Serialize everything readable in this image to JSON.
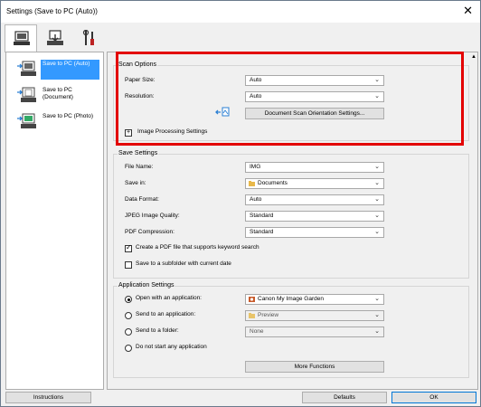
{
  "window": {
    "title": "Settings (Save to PC (Auto))",
    "close_glyph": "✕"
  },
  "tabs": [
    {
      "icon": "computer-scan-icon",
      "active": true
    },
    {
      "icon": "scan-to-pc-icon",
      "active": false
    },
    {
      "icon": "tools-icon",
      "active": false
    }
  ],
  "sidebar": {
    "items": [
      {
        "label": "Save to PC (Auto)",
        "selected": true,
        "icon": "save-auto-icon"
      },
      {
        "label": "Save to PC (Document)",
        "selected": false,
        "icon": "save-document-icon"
      },
      {
        "label": "Save to PC (Photo)",
        "selected": false,
        "icon": "save-photo-icon"
      }
    ]
  },
  "scan_options": {
    "group_label": "Scan Options",
    "paper_size": {
      "label": "Paper Size:",
      "value": "Auto"
    },
    "resolution": {
      "label": "Resolution:",
      "value": "Auto"
    },
    "orientation_button": "Document Scan Orientation Settings...",
    "image_processing": {
      "toggle": "+",
      "label": "Image Processing Settings"
    }
  },
  "save_settings": {
    "group_label": "Save Settings",
    "file_name": {
      "label": "File Name:",
      "value": "IMG"
    },
    "save_in": {
      "label": "Save in:",
      "value": "Documents"
    },
    "data_format": {
      "label": "Data Format:",
      "value": "Auto"
    },
    "jpeg_quality": {
      "label": "JPEG Image Quality:",
      "value": "Standard"
    },
    "pdf_compression": {
      "label": "PDF Compression:",
      "value": "Standard"
    },
    "create_pdf_keyword": {
      "label": "Create a PDF file that supports keyword search",
      "checked": true
    },
    "save_subfolder": {
      "label": "Save to a subfolder with current date",
      "checked": false
    }
  },
  "application_settings": {
    "group_label": "Application Settings",
    "open_with_app": {
      "label": "Open with an application:",
      "selected": true,
      "value": "Canon My Image Garden"
    },
    "send_to_app": {
      "label": "Send to an application:",
      "selected": false,
      "value": "Preview"
    },
    "send_to_folder": {
      "label": "Send to a folder:",
      "selected": false,
      "value": "None"
    },
    "do_not_start": {
      "label": "Do not start any application",
      "selected": false
    },
    "more_functions": "More Functions"
  },
  "footer": {
    "instructions": "Instructions",
    "defaults": "Defaults",
    "ok": "OK"
  },
  "colors": {
    "highlight": "#e30000",
    "selection": "#3399ff"
  }
}
